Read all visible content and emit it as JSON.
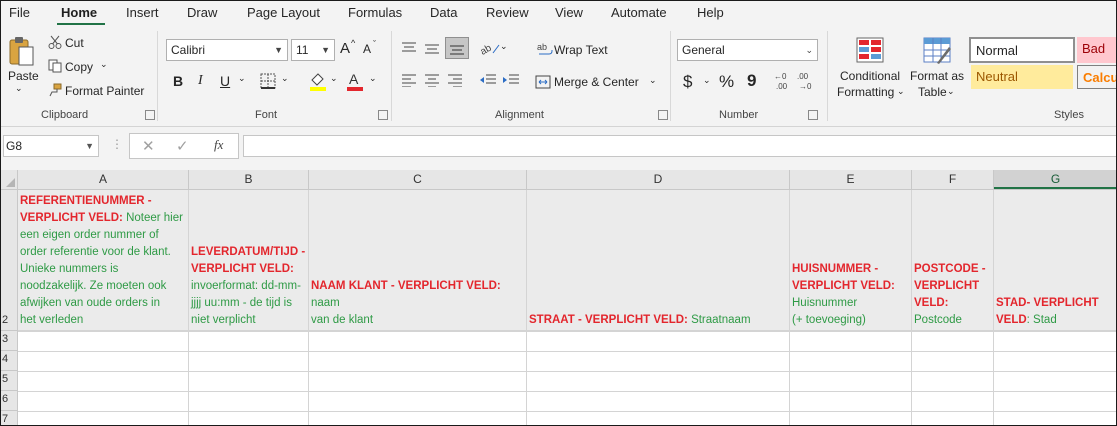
{
  "menu": {
    "items": [
      "File",
      "Home",
      "Insert",
      "Draw",
      "Page Layout",
      "Formulas",
      "Data",
      "Review",
      "View",
      "Automate",
      "Help"
    ],
    "active": "Home"
  },
  "clipboard": {
    "paste": "Paste",
    "cut": "Cut",
    "copy": "Copy",
    "format_painter": "Format Painter",
    "label": "Clipboard"
  },
  "font": {
    "name": "Calibri",
    "size": "11",
    "bold": "B",
    "italic": "I",
    "underline": "U",
    "label": "Font",
    "grow": "A",
    "shrink": "A"
  },
  "alignment": {
    "wrap_text": "Wrap Text",
    "merge_center": "Merge & Center",
    "label": "Alignment"
  },
  "number": {
    "format": "General",
    "currency": "$",
    "percent": "%",
    "comma": "9",
    "label": "Number"
  },
  "styles": {
    "conditional_formatting": "Conditional",
    "conditional_formatting_2": "Formatting",
    "format_as_table": "Format as",
    "format_as_table_2": "Table",
    "normal": "Normal",
    "bad": "Bad",
    "neutral": "Neutral",
    "calc": "Calcu",
    "label": "Styles"
  },
  "formula_bar": {
    "name_box": "G8",
    "formula": ""
  },
  "colors": {
    "accent": "#217346",
    "red_text": "#e3262d",
    "green_text": "#2e9a45",
    "bad_bg": "#ffc7ce",
    "neutral_bg": "#ffeb9c"
  },
  "columns": [
    "A",
    "B",
    "C",
    "D",
    "E",
    "F",
    "G"
  ],
  "selected_column": "G",
  "rows": [
    "2",
    "3",
    "4",
    "5",
    "6",
    "7"
  ],
  "cells": {
    "A2": {
      "red": "REFERENTIENUMMER -\nVERPLICHT VELD:",
      "green": " Noteer hier\neen eigen order nummer of\norder referentie voor de klant.\nUnieke nummers is\nnoodzakelijk. Ze moeten ook\nafwijken van oude orders in\nhet verleden"
    },
    "B2": {
      "red": "LEVERDATUM/TIJD -\nVERPLICHT VELD:",
      "green": "\ninvoerformat: dd-mm-\njjjj uu:mm - de tijd is\nniet verplicht"
    },
    "C2": {
      "red": "NAAM KLANT - VERPLICHT VELD:",
      "green": " naam\nvan de klant"
    },
    "D2": {
      "red": "STRAAT - VERPLICHT VELD:",
      "green": " Straatnaam"
    },
    "E2": {
      "red": "HUISNUMMER -\nVERPLICHT VELD:",
      "green": "\nHuisnummer\n(+ toevoeging)"
    },
    "F2": {
      "red": "POSTCODE -\nVERPLICHT\nVELD:",
      "green": "\nPostcode"
    },
    "G2": {
      "red": "STAD- VERPLICHT\nVELD",
      "green": ": Stad"
    }
  }
}
